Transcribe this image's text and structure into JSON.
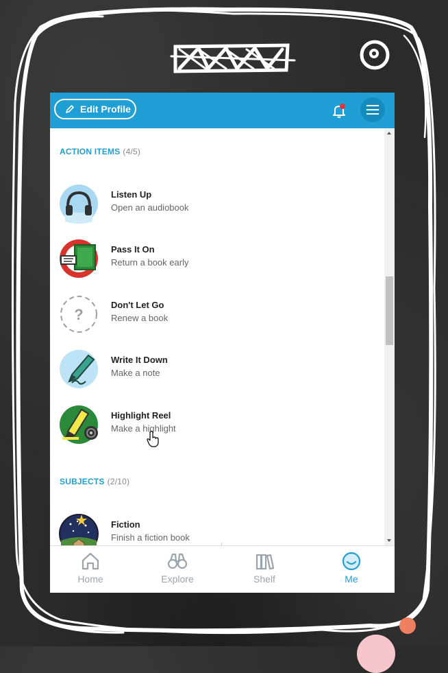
{
  "header": {
    "edit_profile_label": "Edit Profile",
    "has_notification": true
  },
  "sections": {
    "action_items": {
      "label": "ACTION ITEMS",
      "count": "(4/5)"
    },
    "subjects": {
      "label": "SUBJECTS",
      "count": "(2/10)"
    }
  },
  "action_items": [
    {
      "title": "Listen Up",
      "subtitle": "Open an audiobook",
      "icon": "headphones-icon"
    },
    {
      "title": "Pass It On",
      "subtitle": "Return a book early",
      "icon": "return-book-icon"
    },
    {
      "title": "Don't Let Go",
      "subtitle": "Renew a book",
      "icon": "locked-question-icon"
    },
    {
      "title": "Write It Down",
      "subtitle": "Make a note",
      "icon": "pen-icon"
    },
    {
      "title": "Highlight Reel",
      "subtitle": "Make a highlight",
      "icon": "highlighter-icon"
    }
  ],
  "subjects": [
    {
      "title": "Fiction",
      "subtitle": "Finish a fiction book",
      "icon": "fiction-icon"
    }
  ],
  "bottom_nav": [
    {
      "label": "Home",
      "icon": "home-icon",
      "active": false
    },
    {
      "label": "Explore",
      "icon": "binoculars-icon",
      "active": false
    },
    {
      "label": "Shelf",
      "icon": "books-icon",
      "active": false
    },
    {
      "label": "Me",
      "icon": "smiley-icon",
      "active": true
    }
  ],
  "colors": {
    "accent": "#1f9fd6",
    "notification_dot": "#e8323a",
    "chalkboard": "#2b2b2b"
  }
}
